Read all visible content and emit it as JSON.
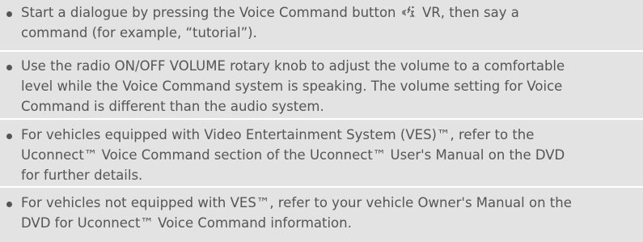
{
  "bullets": [
    {
      "lines": [
        "Start a dialogue by pressing the Voice Command button",
        "command (for example, “tutorial”)."
      ],
      "button_label": "VR",
      "line1_tail": ", then say a",
      "icon": "voice-command-icon"
    },
    {
      "lines": [
        "Use the radio ON/OFF VOLUME rotary knob to adjust the volume to a comfortable",
        "level while the Voice Command system is speaking. The volume setting for Voice",
        "Command is different than the audio system."
      ]
    },
    {
      "lines": [
        "For vehicles equipped with Video Entertainment System (VES)™, refer to the",
        "Uconnect™ Voice Command section of the Uconnect™ User's Manual on the DVD",
        "for further details."
      ]
    },
    {
      "lines": [
        "For vehicles not equipped with VES™, refer to your vehicle Owner's Manual on the",
        "DVD for Uconnect™ Voice Command information."
      ]
    }
  ],
  "colors": {
    "background": "#e3e3e3",
    "separator": "#ffffff",
    "text": "#555555"
  }
}
